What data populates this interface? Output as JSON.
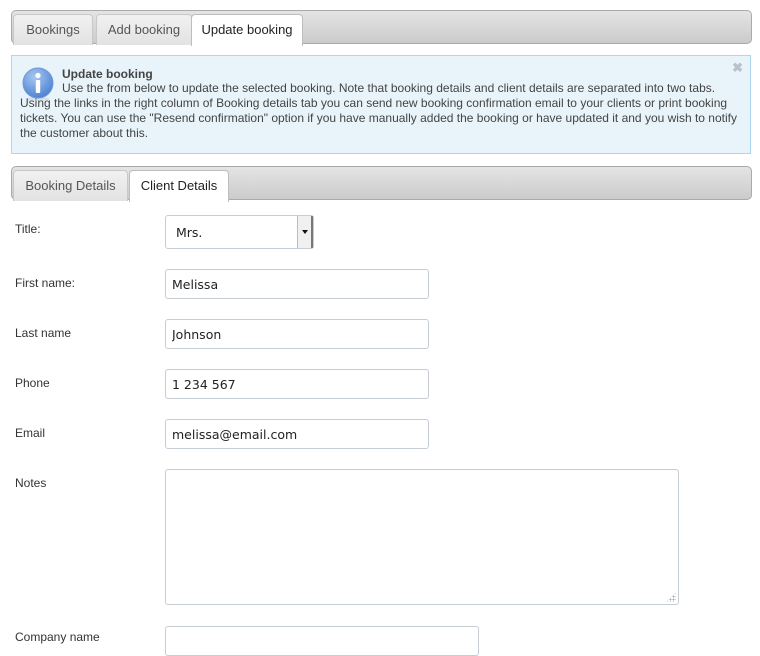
{
  "main_tabs": [
    {
      "label": "Bookings",
      "active": false
    },
    {
      "label": "Add booking",
      "active": false
    },
    {
      "label": "Update booking",
      "active": true
    }
  ],
  "info_box": {
    "icon": "info-icon",
    "title": "Update booking",
    "text": "Use the from below to update the selected booking. Note that booking details and client details are separated into two tabs. Using the links in the right column of Booking details tab you can send new booking confirmation email to your clients or print booking tickets. You can use the \"Resend confirmation\" option if you have manually added the booking or have updated it and you wish to notify the customer about this.",
    "close_icon": "close-icon",
    "close_glyph": "✖"
  },
  "sub_tabs": [
    {
      "label": "Booking Details",
      "active": false
    },
    {
      "label": "Client Details",
      "active": true
    }
  ],
  "form": {
    "title": {
      "label": "Title:",
      "value": "Mrs."
    },
    "first_name": {
      "label": "First name:",
      "value": "Melissa"
    },
    "last_name": {
      "label": "Last name",
      "value": "Johnson"
    },
    "phone": {
      "label": "Phone",
      "value": "1 234 567"
    },
    "email": {
      "label": "Email",
      "value": "melissa@email.com"
    },
    "notes": {
      "label": "Notes",
      "value": ""
    },
    "company_name": {
      "label": "Company name",
      "value": ""
    }
  },
  "colors": {
    "info_background": "#e8f4fa",
    "info_border": "#a9d8ef",
    "icon_blue": "#5b8fd8"
  }
}
